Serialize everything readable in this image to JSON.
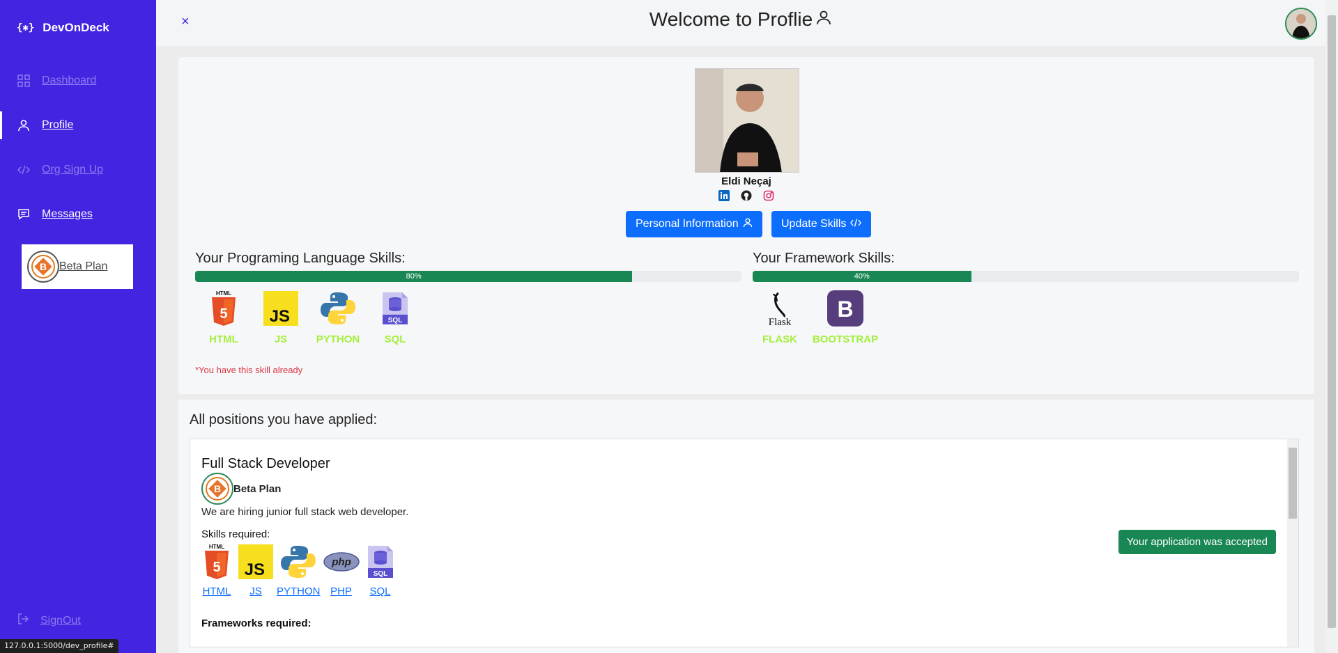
{
  "app": {
    "name": "DevOnDeck",
    "logo_glyph": "{✱}"
  },
  "sidebar": {
    "items": [
      {
        "label": "Dashboard",
        "icon": "grid-icon"
      },
      {
        "label": "Profile",
        "icon": "user-icon"
      },
      {
        "label": "Org Sign Up",
        "icon": "code-icon"
      },
      {
        "label": "Messages",
        "icon": "message-icon"
      }
    ],
    "org_card": {
      "label": "Beta Plan"
    },
    "signout": "SignOut"
  },
  "status_url": "127.0.0.1:5000/dev_profile#",
  "header": {
    "title": "Welcome to Proflie",
    "close": "×"
  },
  "profile": {
    "name": "Eldi Neçaj",
    "buttons": {
      "personal": "Personal Information",
      "skills": "Update Skills"
    },
    "languages": {
      "heading": "Your Programing Language Skills:",
      "progress_label": "80%",
      "progress": 80,
      "skills": [
        "HTML",
        "JS",
        "PYTHON",
        "SQL"
      ]
    },
    "frameworks": {
      "heading": "Your Framework Skills:",
      "progress_label": "40%",
      "progress": 40,
      "skills": [
        "FLASK",
        "BOOTSTRAP"
      ]
    },
    "hint": "*You have this skill already"
  },
  "applications": {
    "heading": "All positions you have applied:",
    "job": {
      "title": "Full Stack Developer",
      "org": "Beta Plan",
      "description": "We are hiring junior full stack web developer.",
      "skills_label": "Skills required:",
      "skills": [
        "HTML",
        "JS",
        "PYTHON",
        "PHP",
        "SQL"
      ],
      "frameworks_label": "Frameworks required:",
      "status": "Your application was accepted"
    }
  },
  "colors": {
    "sidebar": "#4324e0",
    "primary": "#0d6efd",
    "success": "#198754",
    "skill_text": "#a3f03c",
    "danger": "#dc3545"
  }
}
